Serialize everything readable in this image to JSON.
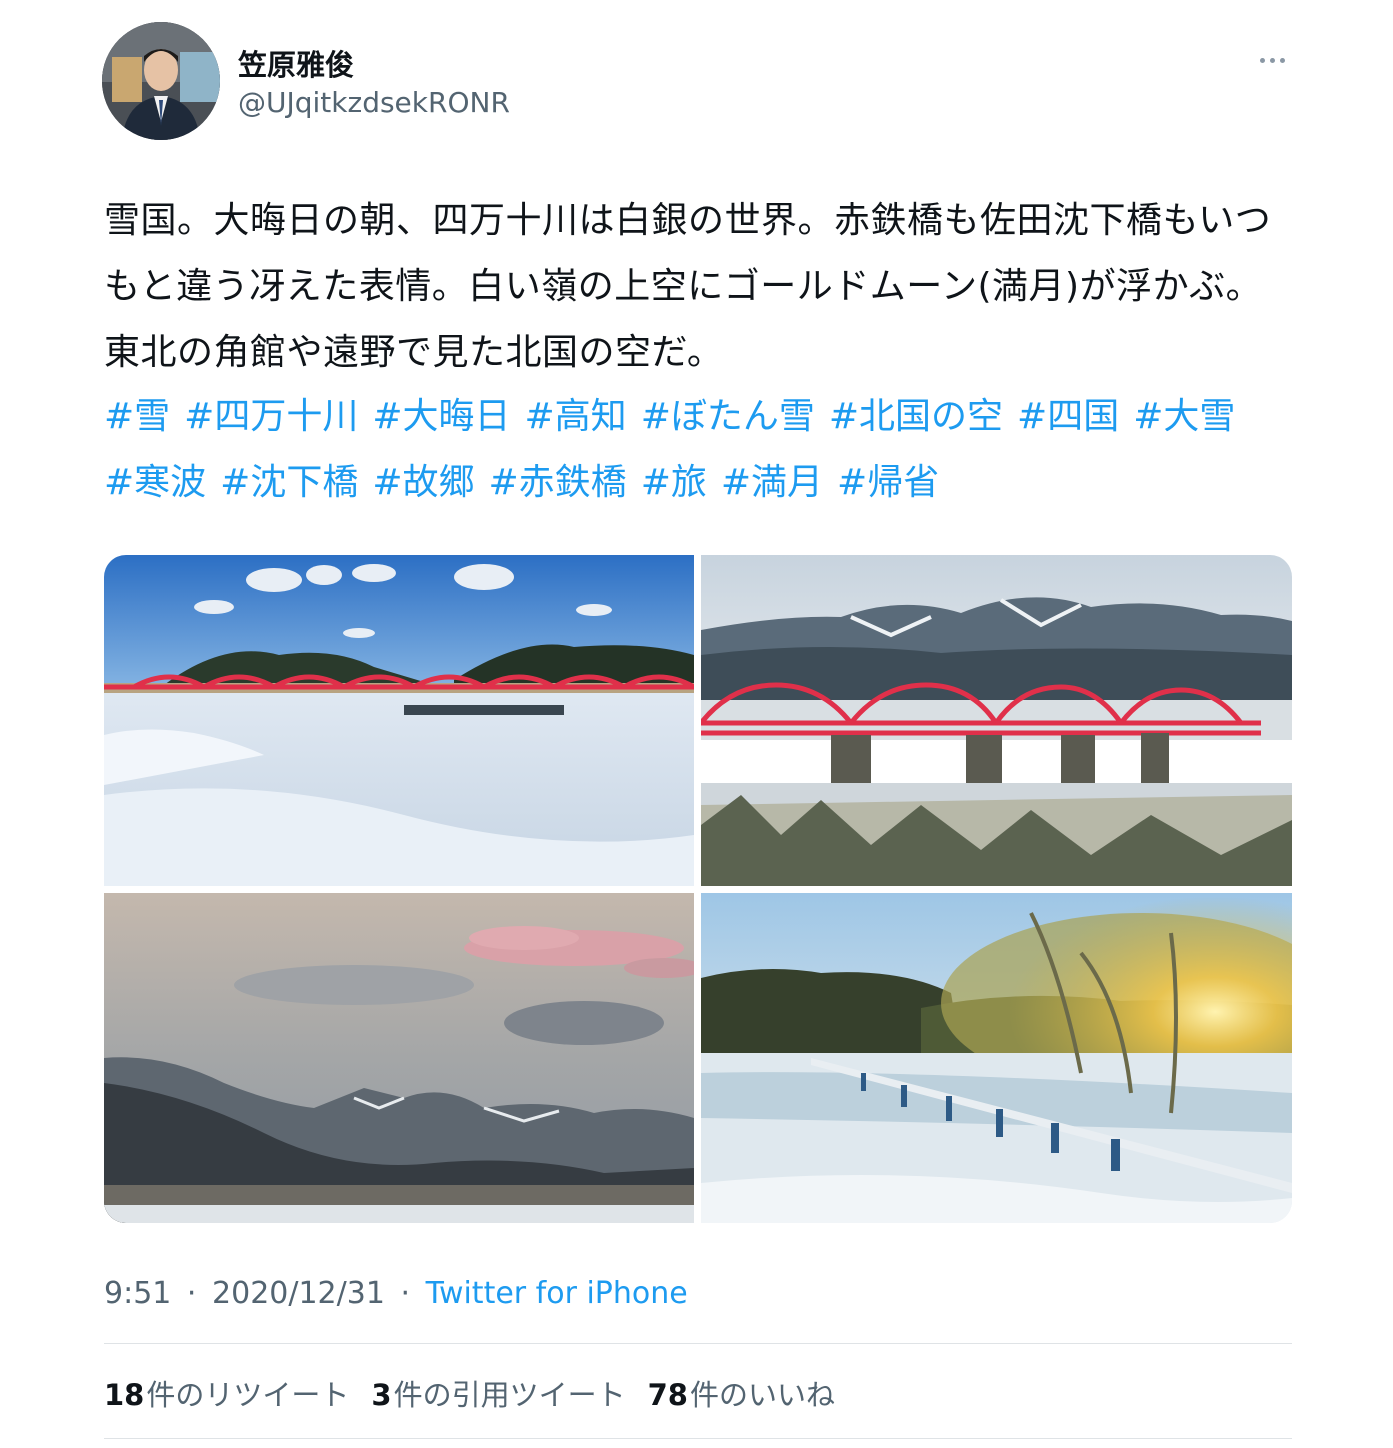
{
  "user": {
    "display_name": "笠原雅俊",
    "handle": "@UJqitkzdsekRONR"
  },
  "more_icon": "more-horizontal-icon",
  "tweet": {
    "text": "雪国。大晦日の朝、四万十川は白銀の世界。赤鉄橋も佐田沈下橋もいつもと違う冴えた表情。白い嶺の上空にゴールドムーン(満月)が浮かぶ。東北の角館や遠野で見た北国の空だ。",
    "hashtags": [
      "#雪",
      "#四万十川",
      "#大晦日",
      "#高知",
      "#ぼたん雪",
      "#北国の空",
      "#四国",
      "#大雪",
      "#寒波",
      "#沈下橋",
      "#故郷",
      "#赤鉄橋",
      "#旅",
      "#満月",
      "#帰省"
    ]
  },
  "meta": {
    "time": "9:51",
    "separator": "·",
    "date": "2020/12/31",
    "source": "Twitter for iPhone"
  },
  "stats": {
    "retweets_count": "18",
    "retweets_label": "件のリツイート",
    "quotes_count": "3",
    "quotes_label": "件の引用ツイート",
    "likes_count": "78",
    "likes_label": "件のいいね"
  },
  "colors": {
    "link": "#1d9bf0",
    "text": "#0f1419",
    "secondary": "#536471",
    "bridge_red": "#e0304a"
  }
}
